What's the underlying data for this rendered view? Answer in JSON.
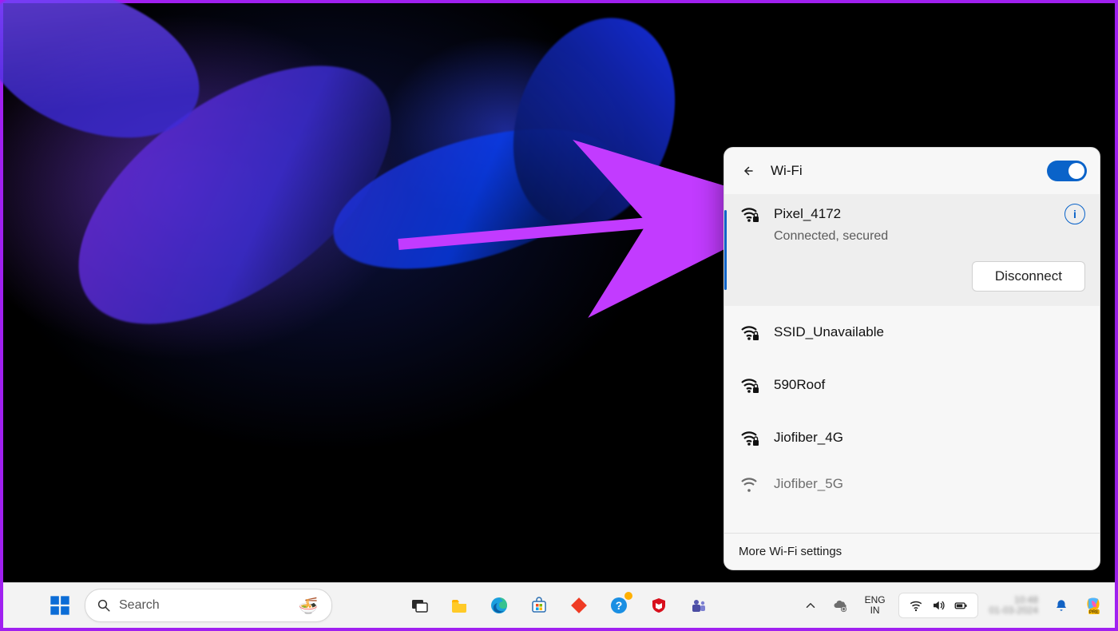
{
  "wifi_panel": {
    "title": "Wi-Fi",
    "toggle_on": true,
    "connected": {
      "ssid": "Pixel_4172",
      "status": "Connected, secured",
      "disconnect_label": "Disconnect"
    },
    "available": [
      {
        "ssid": "SSID_Unavailable"
      },
      {
        "ssid": "590Roof"
      },
      {
        "ssid": "Jiofiber_4G"
      }
    ],
    "partial": {
      "ssid": "Jiofiber_5G"
    },
    "footer": "More Wi-Fi settings"
  },
  "taskbar": {
    "search_placeholder": "Search",
    "language": {
      "line1": "ENG",
      "line2": "IN"
    },
    "clock": {
      "time": "10:48",
      "date": "01-03-2024"
    }
  }
}
